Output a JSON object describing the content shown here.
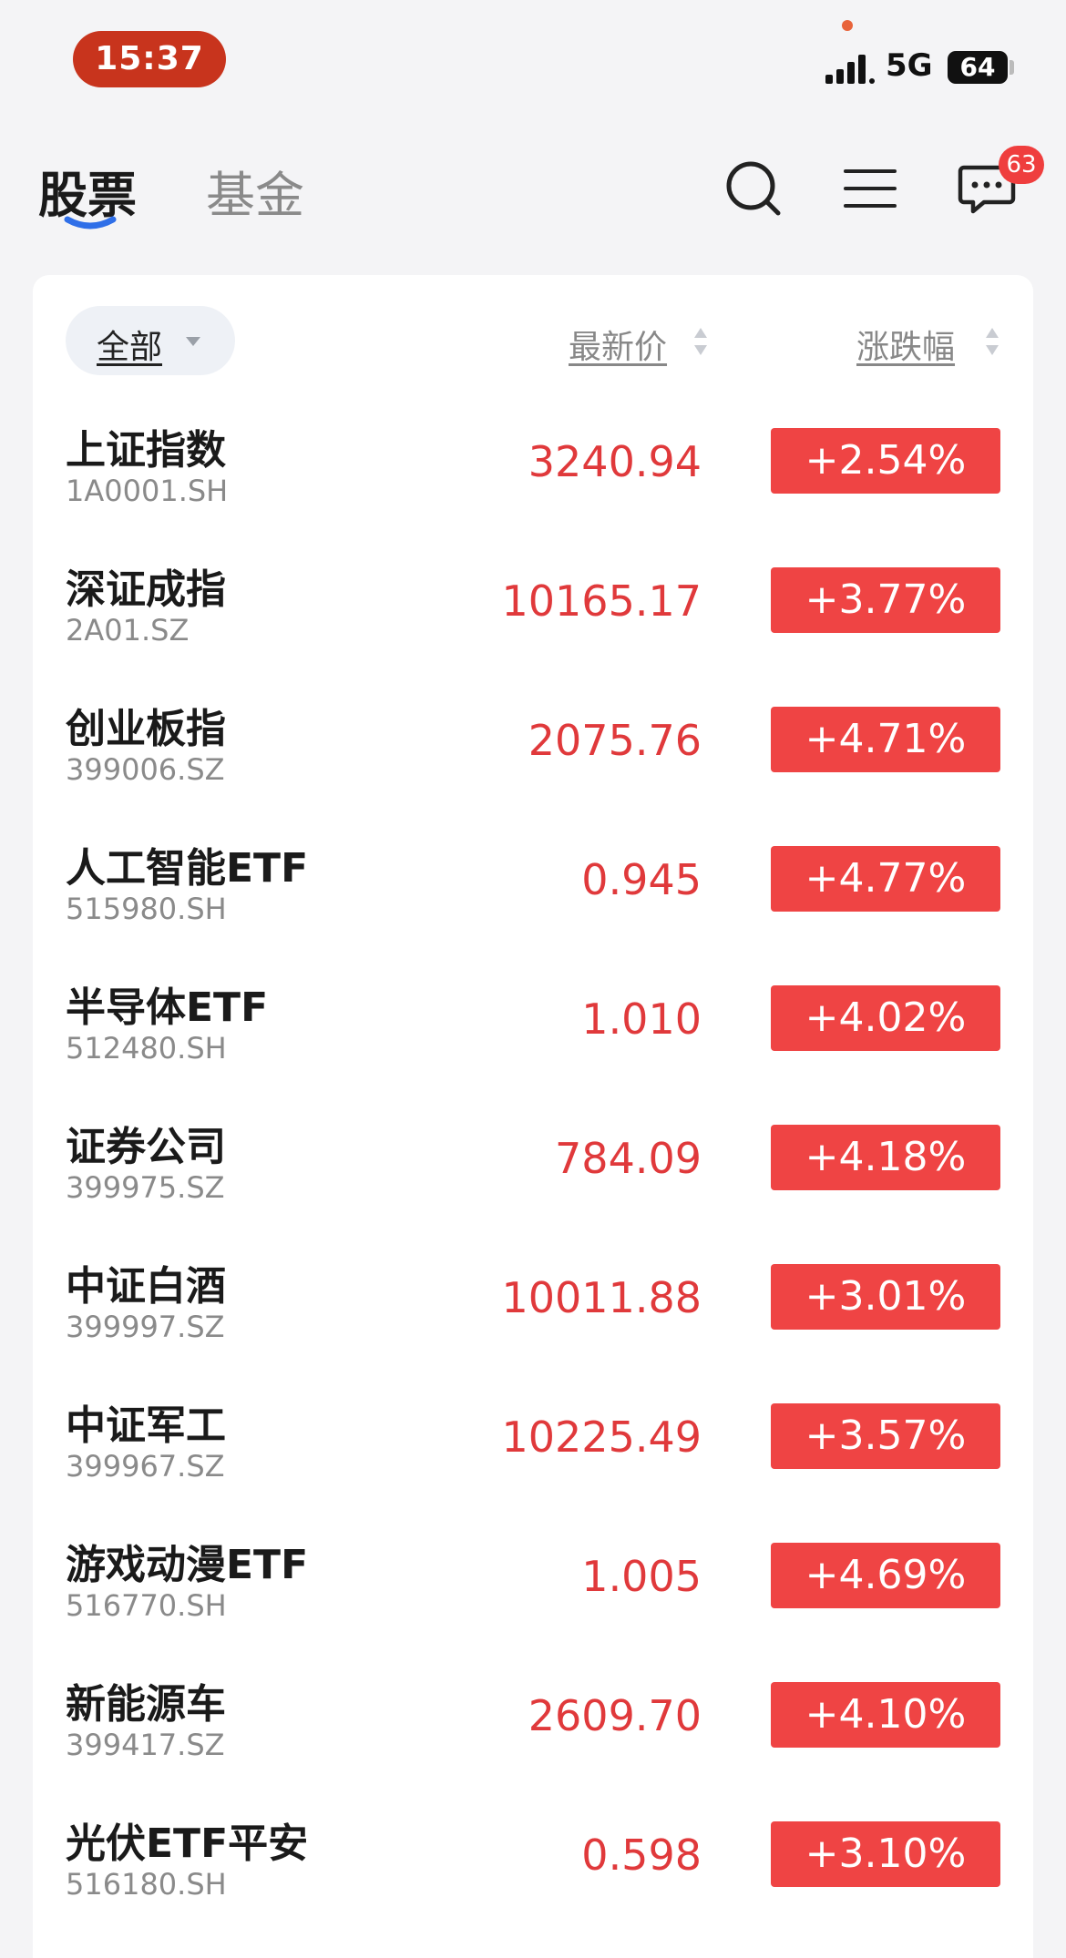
{
  "status_bar": {
    "time": "15:37",
    "network": "5G",
    "battery": "64"
  },
  "header": {
    "tabs": [
      {
        "label": "股票",
        "active": true
      },
      {
        "label": "基金",
        "active": false
      }
    ],
    "icons": [
      "search-icon",
      "menu-icon",
      "message-icon"
    ],
    "message_badge": "63"
  },
  "filter": {
    "label": "全部"
  },
  "columns": {
    "price": "最新价",
    "change": "涨跌幅"
  },
  "colors": {
    "up": "#ef4444",
    "time_pill": "#c8341d",
    "accent": "#2f6fe8"
  },
  "stocks": [
    {
      "name": "上证指数",
      "code": "1A0001.SH",
      "price": "3240.94",
      "change": "+2.54%"
    },
    {
      "name": "深证成指",
      "code": "2A01.SZ",
      "price": "10165.17",
      "change": "+3.77%"
    },
    {
      "name": "创业板指",
      "code": "399006.SZ",
      "price": "2075.76",
      "change": "+4.71%"
    },
    {
      "name": "人工智能ETF",
      "code": "515980.SH",
      "price": "0.945",
      "change": "+4.77%"
    },
    {
      "name": "半导体ETF",
      "code": "512480.SH",
      "price": "1.010",
      "change": "+4.02%"
    },
    {
      "name": "证券公司",
      "code": "399975.SZ",
      "price": "784.09",
      "change": "+4.18%"
    },
    {
      "name": "中证白酒",
      "code": "399997.SZ",
      "price": "10011.88",
      "change": "+3.01%"
    },
    {
      "name": "中证军工",
      "code": "399967.SZ",
      "price": "10225.49",
      "change": "+3.57%"
    },
    {
      "name": "游戏动漫ETF",
      "code": "516770.SH",
      "price": "1.005",
      "change": "+4.69%"
    },
    {
      "name": "新能源车",
      "code": "399417.SZ",
      "price": "2609.70",
      "change": "+4.10%"
    },
    {
      "name": "光伏ETF平安",
      "code": "516180.SH",
      "price": "0.598",
      "change": "+3.10%"
    }
  ]
}
